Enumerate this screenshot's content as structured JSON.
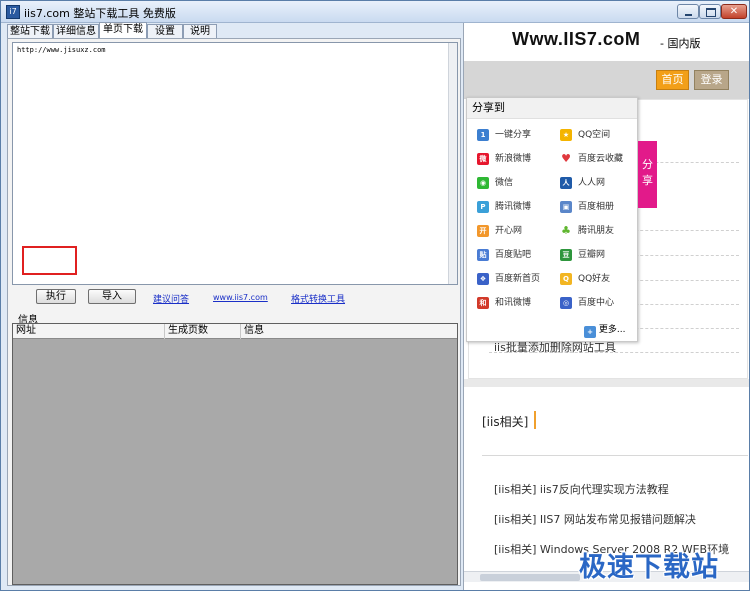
{
  "window": {
    "title": "iis7.com 整站下载工具 免费版",
    "icon_text": "i7"
  },
  "tabs": [
    {
      "label": "整站下载"
    },
    {
      "label": "详细信息"
    },
    {
      "label": "单页下载"
    },
    {
      "label": "设置"
    },
    {
      "label": "说明"
    }
  ],
  "url_input": {
    "value": "http://www.jisuxz.com"
  },
  "actions": {
    "execute_label": "执行",
    "import_label": "导入",
    "suggest_link": "建议问答",
    "site_link": "www.iis7.com",
    "convert_link": "格式转换工具"
  },
  "info_label": "信息",
  "grid": {
    "columns": [
      "网址",
      "生成页数",
      "信息"
    ]
  },
  "browser": {
    "site_title": "Www.IIS7.coM",
    "site_subtitle": "- 国内版",
    "home_label": "首页",
    "login_label": "登录",
    "share_tab": [
      "分",
      "享"
    ],
    "share_panel": {
      "title": "分享到",
      "items": [
        {
          "label": "一键分享",
          "icon": "oneclick-share-icon",
          "color": "#3c7fd0"
        },
        {
          "label": "QQ空间",
          "icon": "qzone-icon",
          "color": "#f4b400"
        },
        {
          "label": "新浪微博",
          "icon": "weibo-icon",
          "color": "#e6162d"
        },
        {
          "label": "百度云收藏",
          "icon": "heart-icon",
          "color": "#e0383e"
        },
        {
          "label": "微信",
          "icon": "wechat-icon",
          "color": "#2fb834"
        },
        {
          "label": "人人网",
          "icon": "renren-icon",
          "color": "#1f5aa8"
        },
        {
          "label": "腾讯微博",
          "icon": "tencent-weibo-icon",
          "color": "#3aa0d8"
        },
        {
          "label": "百度相册",
          "icon": "photo-album-icon",
          "color": "#5a86c9"
        },
        {
          "label": "开心网",
          "icon": "kaixin-icon",
          "color": "#f2972b"
        },
        {
          "label": "腾讯朋友",
          "icon": "clover-icon",
          "color": "#5fb62f"
        },
        {
          "label": "百度贴吧",
          "icon": "tieba-icon",
          "color": "#4a7cd4"
        },
        {
          "label": "豆瓣网",
          "icon": "douban-icon",
          "color": "#2e963d"
        },
        {
          "label": "百度新首页",
          "icon": "paw-icon",
          "color": "#3a62c8"
        },
        {
          "label": "QQ好友",
          "icon": "qq-icon",
          "color": "#f2b522"
        },
        {
          "label": "和讯微博",
          "icon": "hexun-icon",
          "color": "#d23a2a"
        },
        {
          "label": "百度中心",
          "icon": "baidu-center-icon",
          "color": "#3a62c8"
        }
      ],
      "more_label": "更多..."
    },
    "bg_text": "iis批量添加删除网站工具",
    "section_title": "[iis相关]",
    "articles": [
      "[iis相关] iis7反向代理实现方法教程",
      "[iis相关] IIS7 网站发布常见报错问题解决",
      "[iis相关] Windows Server 2008 R2 WEB环境"
    ]
  },
  "watermark": "极速下载站"
}
